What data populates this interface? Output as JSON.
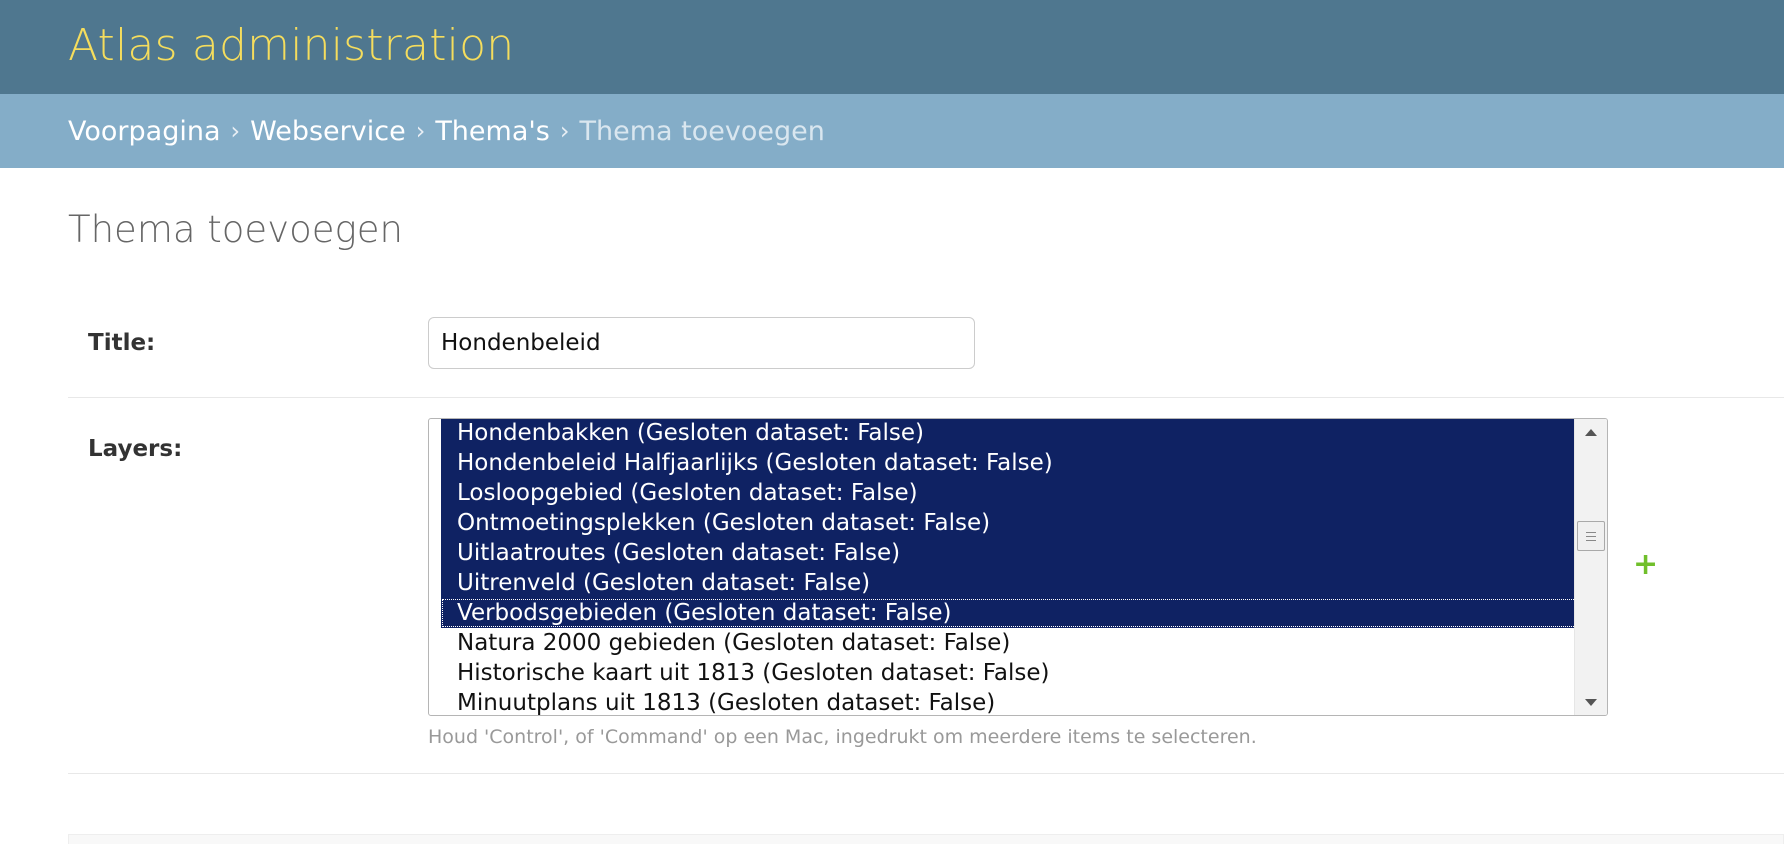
{
  "header": {
    "site_title": "Atlas administration"
  },
  "breadcrumbs": {
    "items": [
      "Voorpagina",
      "Webservice",
      "Thema's"
    ],
    "separator": "›",
    "current": "Thema toevoegen"
  },
  "page_title": "Thema toevoegen",
  "form": {
    "title_label": "Title:",
    "title_value": "Hondenbeleid",
    "layers_label": "Layers:",
    "layers_options": [
      {
        "label": "Hondenbakken (Gesloten dataset: False)",
        "selected": true
      },
      {
        "label": "Hondenbeleid Halfjaarlijks (Gesloten dataset: False)",
        "selected": true
      },
      {
        "label": "Losloopgebied (Gesloten dataset: False)",
        "selected": true
      },
      {
        "label": "Ontmoetingsplekken (Gesloten dataset: False)",
        "selected": true
      },
      {
        "label": "Uitlaatroutes (Gesloten dataset: False)",
        "selected": true
      },
      {
        "label": "Uitrenveld (Gesloten dataset: False)",
        "selected": true
      },
      {
        "label": "Verbodsgebieden (Gesloten dataset: False)",
        "selected": true
      },
      {
        "label": "Natura 2000 gebieden (Gesloten dataset: False)",
        "selected": false
      },
      {
        "label": "Historische kaart uit 1813 (Gesloten dataset: False)",
        "selected": false
      },
      {
        "label": "Minuutplans uit 1813 (Gesloten dataset: False)",
        "selected": false
      }
    ],
    "add_icon": "+",
    "help_text": "Houd 'Control', of 'Command' op een Mac, ingedrukt om meerdere items te selecteren."
  },
  "colors": {
    "header_bg": "#4f778f",
    "site_title": "#f5dd5d",
    "breadcrumb_bg": "#84adc8",
    "selected_bg": "#0f2263",
    "add_icon": "#70bf2b"
  }
}
